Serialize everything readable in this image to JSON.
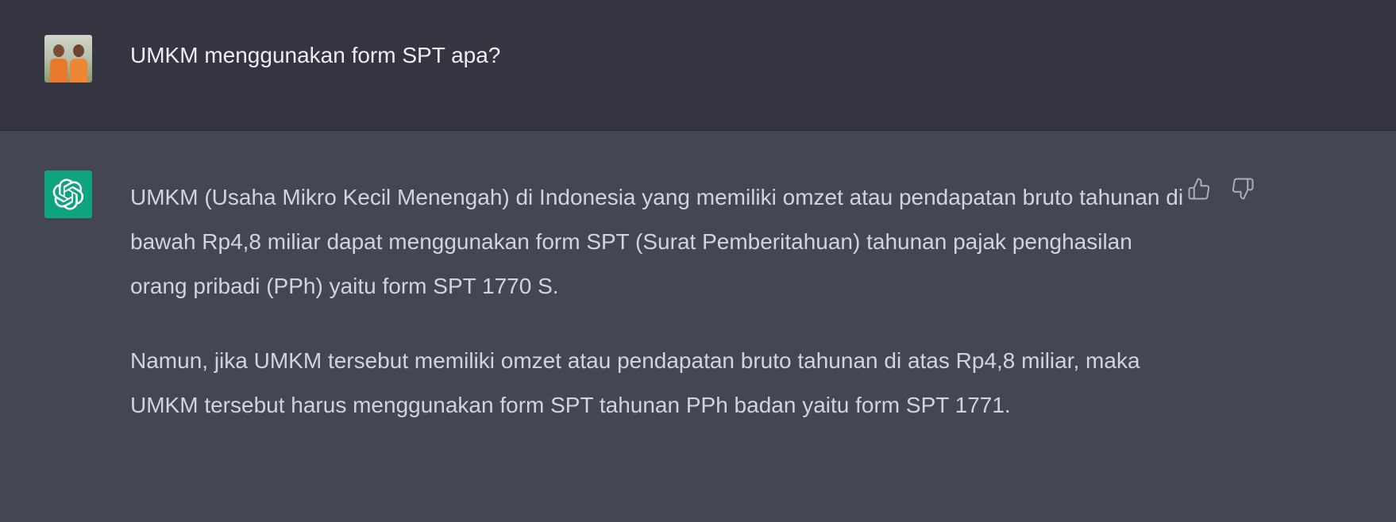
{
  "user_message": {
    "text": "UMKM menggunakan form SPT apa?",
    "avatar_icon": "user-photo-avatar"
  },
  "assistant_message": {
    "avatar_icon": "openai-logo-icon",
    "avatar_color": "#10a37f",
    "paragraphs": [
      "UMKM (Usaha Mikro Kecil Menengah) di Indonesia yang memiliki omzet atau pendapatan bruto tahunan di bawah Rp4,8 miliar dapat menggunakan form SPT (Surat Pemberitahuan) tahunan pajak penghasilan orang pribadi (PPh) yaitu form SPT 1770 S.",
      "Namun, jika UMKM tersebut memiliki omzet atau pendapatan bruto tahunan di atas Rp4,8 miliar, maka UMKM tersebut harus menggunakan form SPT tahunan PPh badan yaitu form SPT 1771."
    ]
  },
  "feedback": {
    "thumbs_up_icon": "thumbs-up-icon",
    "thumbs_down_icon": "thumbs-down-icon"
  },
  "colors": {
    "user_row_bg": "#343541",
    "assistant_row_bg": "#444654",
    "text": "#d1d5db",
    "icon": "#acacbe"
  }
}
